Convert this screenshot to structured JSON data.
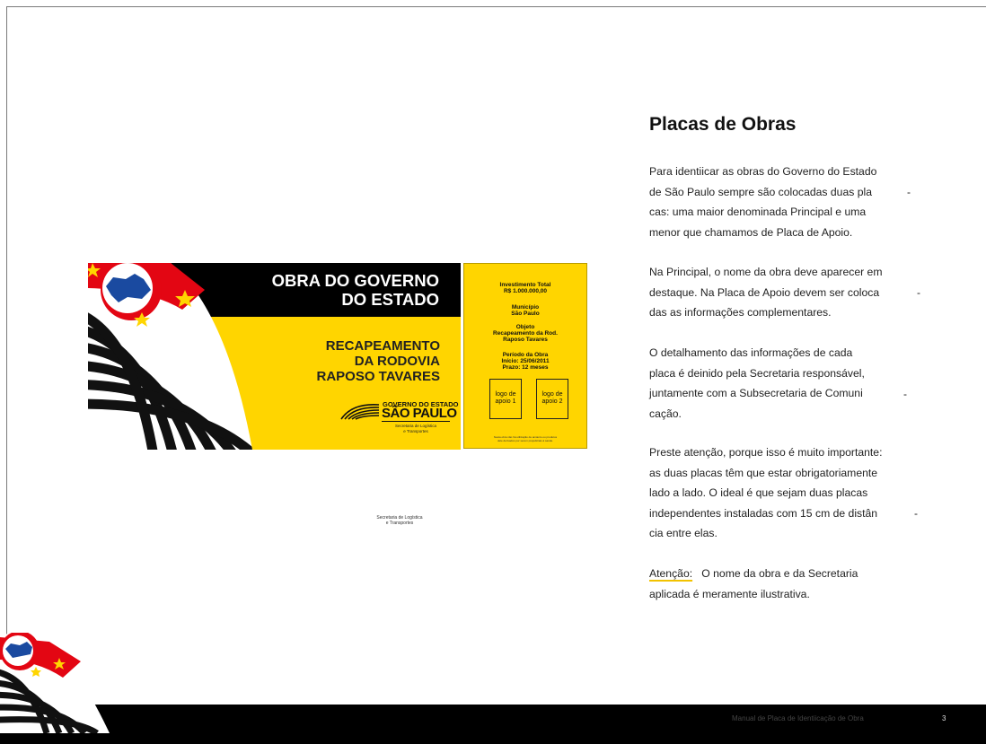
{
  "main_sign": {
    "title_line1": "OBRA DO GOVERNO",
    "title_line2": "DO ESTADO",
    "work_line1": "RECAPEAMENTO",
    "work_line2": "DA RODOVIA",
    "work_line3": "RAPOSO TAVARES",
    "logo_line1": "GOVERNO DO ESTADO",
    "logo_line2": "SÃO PAULO",
    "secretariat_line1": "Secretaria de Logística",
    "secretariat_line2": "e Transportes"
  },
  "support_sign": {
    "investment_label": "Investimento Total",
    "investment_value": "R$ 1.000.000,00",
    "municipality_label": "Município",
    "municipality_value": "São Paulo",
    "object_label": "Objeto",
    "object_value1": "Recapeamento da Rod.",
    "object_value2": "Raposo Tavares",
    "period_label": "Período da Obra",
    "period_start": "Início: 25/06/2011",
    "period_duration": "Prazo: 12 meses",
    "logo1_line1": "logo de",
    "logo1_line2": "apoio 1",
    "logo2_line1": "logo de",
    "logo2_line2": "apoio 2",
    "fine_print_line1": "Nesta obra não há utilização de amianto ou produtos",
    "fine_print_line2": "dele derivados por serem prejudiciais à saúde."
  },
  "caption": {
    "line1": "Secretaria de Logística",
    "line2": "e Transportes"
  },
  "content": {
    "title": "Placas de Obras",
    "p1": [
      "Para identiicar as obras do Governo do Estado",
      "de São Paulo sempre são colocadas duas pla",
      "cas: uma maior denominada Principal e uma",
      "menor que chamamos de Placa de Apoio."
    ],
    "p2": [
      "Na Principal, o nome da obra deve aparecer em",
      "destaque. Na Placa de Apoio devem ser coloca",
      "das as informações complementares."
    ],
    "p3": [
      "O detalhamento das informações de cada",
      "placa é deinido pela Secretaria responsável,",
      "juntamente com a Subsecretaria de Comuni",
      "cação."
    ],
    "p4": [
      "Preste atenção, porque isso é muito importante:",
      "as duas placas têm que estar obrigatoriamente",
      "lado a lado. O ideal é que sejam duas placas",
      "independentes instaladas com 15 cm de distân",
      "cia entre elas."
    ],
    "attention_label": "Atenção:",
    "attention_text": "O nome da obra e da Secretaria",
    "attention_text2": "aplicada é meramente ilustrativa.",
    "hyphen": "-"
  },
  "footer": {
    "text": "Manual de Placa de Identiicação de Obra",
    "page_number": "3"
  },
  "colors": {
    "sign_yellow": "#ffd500",
    "flag_red": "#e30613",
    "map_blue": "#1a4aa0",
    "black": "#000000"
  }
}
